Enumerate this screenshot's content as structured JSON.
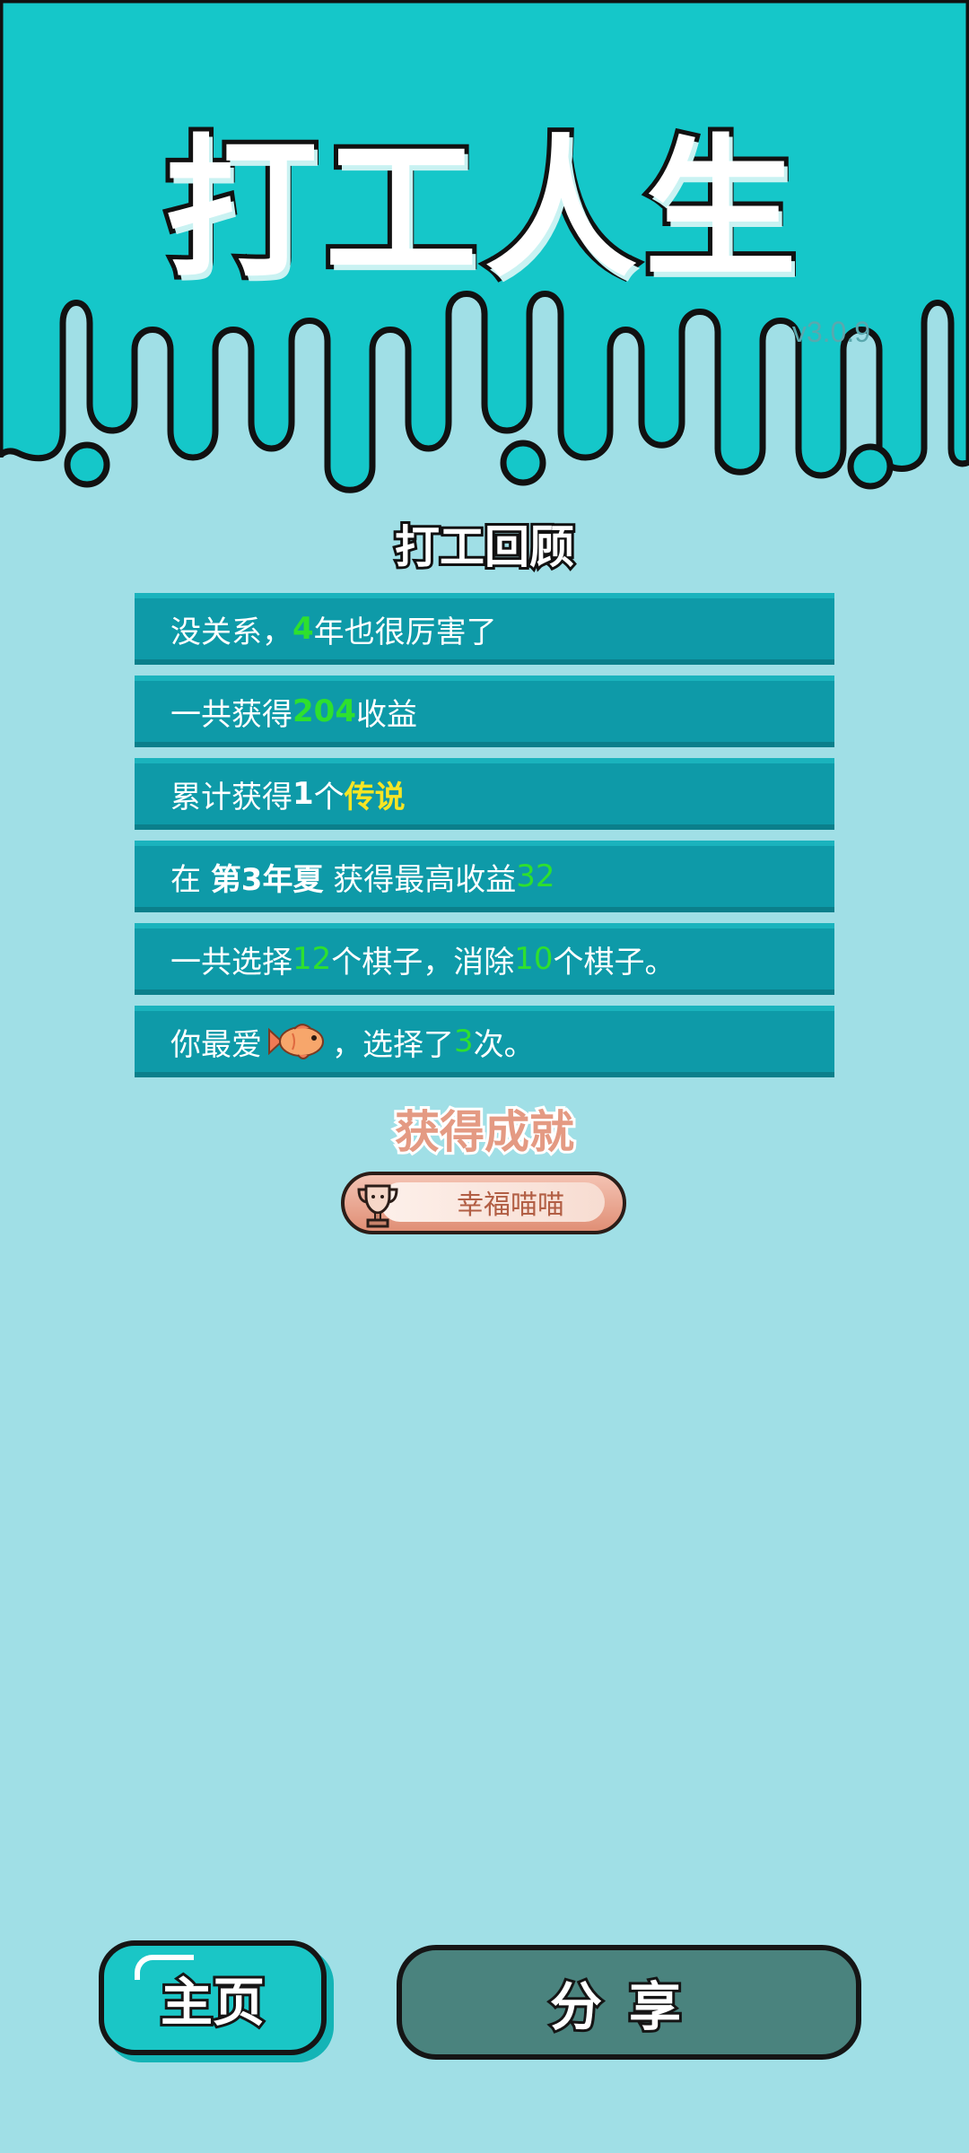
{
  "app": {
    "title": "打工人生",
    "version": "v3.0.9"
  },
  "review": {
    "title": "打工回顾",
    "items": [
      {
        "prefix": "没关系，",
        "value": "4",
        "suffix": "年也很厉害了"
      },
      {
        "prefix": "一共获得",
        "value": "204",
        "suffix": "收益"
      },
      {
        "prefix": "累计获得",
        "value": "1",
        "mid": "个",
        "highlight": "传说"
      },
      {
        "prefix": "在 ",
        "bold": "第3年夏",
        "mid": " 获得最高收益",
        "value": "32"
      },
      {
        "prefix": "一共选择",
        "value": "12",
        "mid": "个棋子，消除",
        "value2": "10",
        "suffix": "个棋子。"
      },
      {
        "prefix": "你最爱",
        "icon": "fish-icon",
        "mid": "，选择了",
        "value": "3",
        "suffix": "次。"
      }
    ]
  },
  "achievements": {
    "title": "获得成就",
    "badge_label": "幸福喵喵",
    "badge_icon": "trophy-icon"
  },
  "buttons": {
    "home": "主页",
    "share": "分享"
  },
  "colors": {
    "header_bg": "#15c7c9",
    "page_bg": "#a0dfe6",
    "card_bg": "#0e9aa8",
    "highlight_green": "#2ee02e",
    "highlight_yellow": "#f6e524",
    "achievement_title": "#e49a83",
    "share_button": "#4a837e",
    "home_button": "#1ac6c6"
  }
}
